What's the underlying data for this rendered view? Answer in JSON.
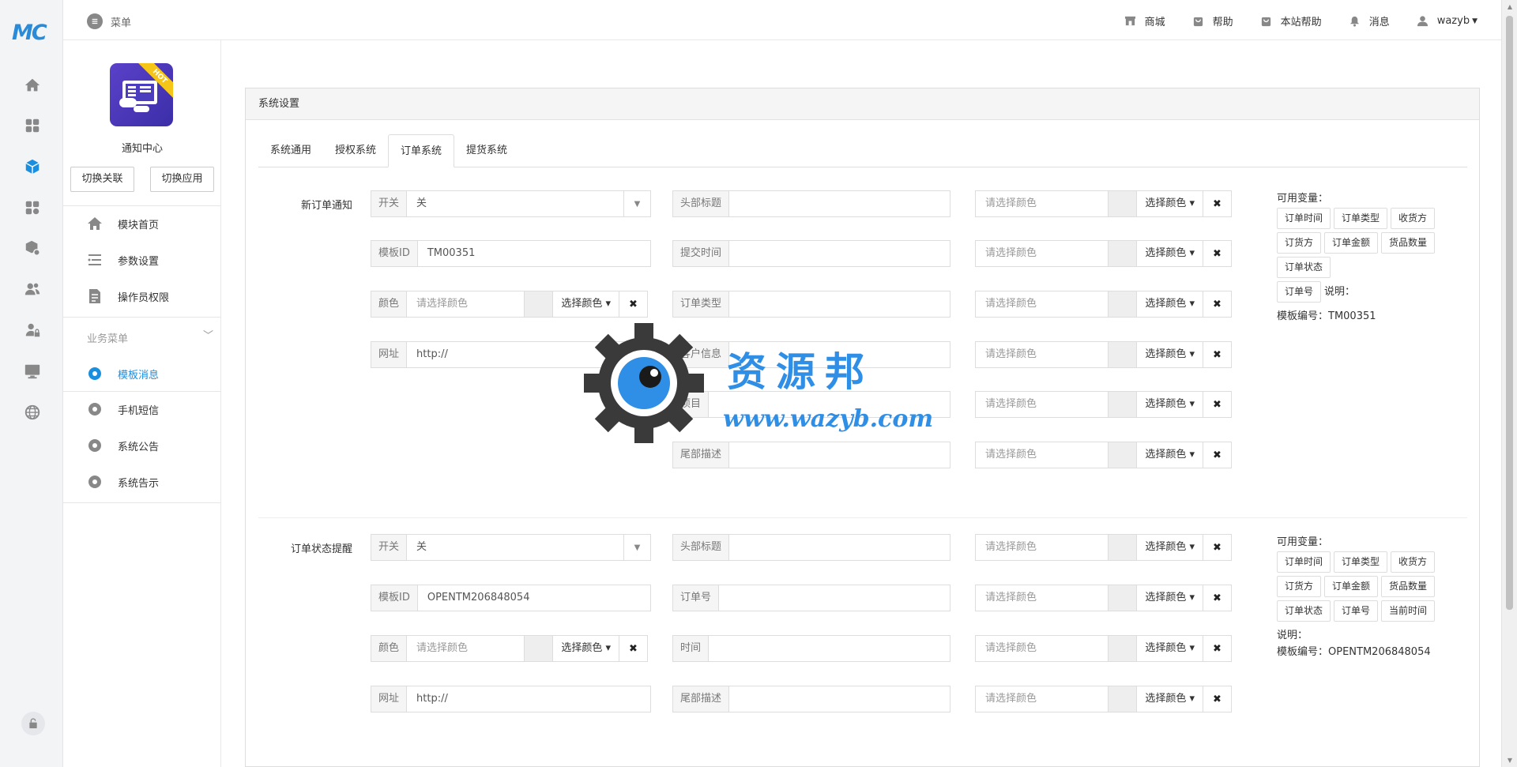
{
  "logo": "MC",
  "rail_icons": [
    "home-icon",
    "grid-icon",
    "cube-icon",
    "apps-icon",
    "package-settings-icon",
    "users-icon",
    "user-lock-icon",
    "monitor-icon",
    "globe-icon",
    "lock-icon"
  ],
  "topbar": {
    "menu_label": "菜单",
    "links": [
      "商城",
      "帮助",
      "本站帮助",
      "消息"
    ],
    "user": "wazyb"
  },
  "sidebar": {
    "app_name": "通知中心",
    "app_badge": "HOT",
    "switch_link": "切换关联",
    "switch_app": "切换应用",
    "items": [
      "模块首页",
      "参数设置",
      "操作员权限"
    ],
    "group_title": "业务菜单",
    "group_items": [
      "模板消息",
      "手机短信",
      "系统公告",
      "系统告示"
    ],
    "active_item": "模板消息"
  },
  "panel": {
    "title": "系统设置",
    "tabs": [
      "系统通用",
      "授权系统",
      "订单系统",
      "提货系统"
    ],
    "active_tab": "订单系统"
  },
  "common": {
    "switch_addon": "开关",
    "switch_value": "关",
    "template_addon": "模板ID",
    "color_addon": "颜色",
    "color_placeholder": "请选择颜色",
    "pick_color": "选择颜色",
    "url_addon": "网址",
    "url_value": "http://",
    "vars_title": "可用变量：",
    "note_label": "说明：",
    "clear": "✖"
  },
  "section1": {
    "label": "新订单通知",
    "template_id": "TM00351",
    "fields": [
      "头部标题",
      "提交时间",
      "订单类型",
      "客户信息",
      "项目",
      "尾部描述"
    ],
    "vars": [
      "订单时间",
      "订单类型",
      "收货方",
      "订货方",
      "订单金额",
      "货品数量",
      "订单状态",
      "订单号"
    ],
    "template_note": "模板编号：TM00351"
  },
  "section2": {
    "label": "订单状态提醒",
    "template_id": "OPENTM206848054",
    "fields": [
      "头部标题",
      "订单号",
      "时间",
      "尾部描述"
    ],
    "vars": [
      "订单时间",
      "订单类型",
      "收货方",
      "订货方",
      "订单金额",
      "货品数量",
      "订单状态",
      "订单号",
      "当前时间"
    ],
    "template_note": "模板编号：OPENTM206848054"
  },
  "watermark": {
    "title": "资源邦",
    "url": "www.wazyb.com"
  }
}
